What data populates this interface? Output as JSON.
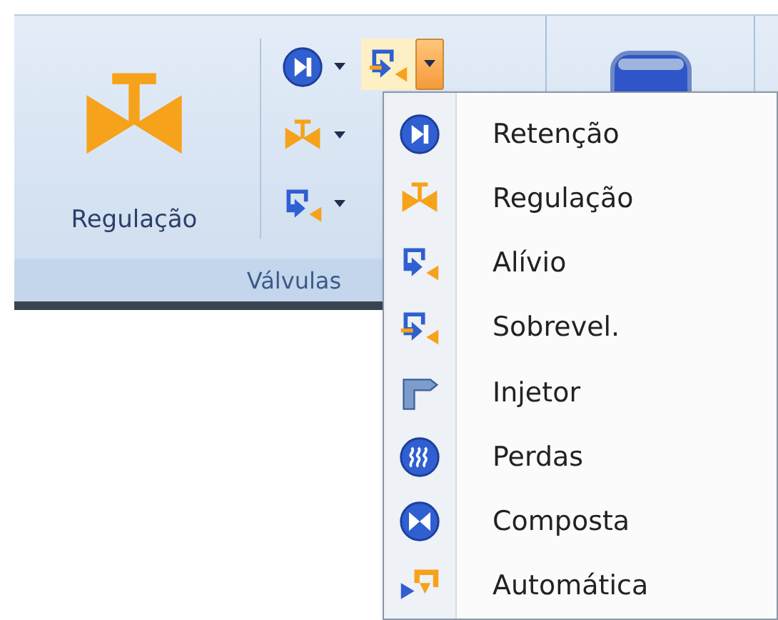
{
  "ribbon": {
    "group": {
      "label": "Válvulas",
      "large_button": {
        "label": "Regulação",
        "kind": "regulation"
      },
      "small_buttons": [
        {
          "kind": "check"
        },
        {
          "kind": "regulation"
        },
        {
          "kind": "relief"
        }
      ],
      "split_button": {
        "kind": "overspeed",
        "expanded": true
      }
    }
  },
  "menu": {
    "items": [
      {
        "kind": "check",
        "label": "Retenção"
      },
      {
        "kind": "regulation",
        "label": "Regulação"
      },
      {
        "kind": "relief",
        "label": "Alívio"
      },
      {
        "kind": "overspeed",
        "label": "Sobrevel."
      },
      {
        "kind": "injector",
        "label": "Injetor"
      },
      {
        "kind": "losses",
        "label": "Perdas"
      },
      {
        "kind": "composite",
        "label": "Composta"
      },
      {
        "kind": "automatic",
        "label": "Automática"
      }
    ]
  }
}
